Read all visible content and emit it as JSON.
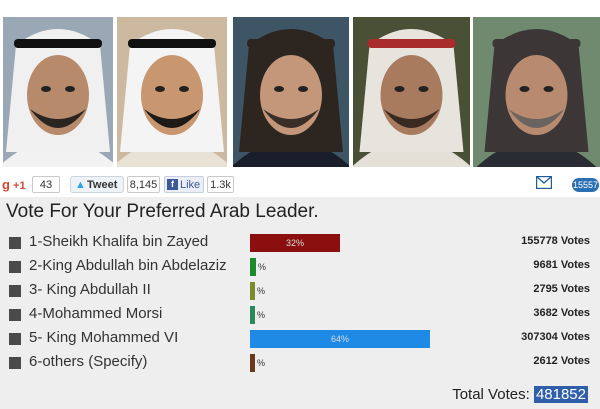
{
  "photos": [
    {
      "name": "leader-photo-1",
      "bg": "#9aa7b5",
      "skin": "#b88a6c",
      "head": "#f0f0f0",
      "band": "#111111",
      "beard": "#2a2520",
      "cloth": "#f2f2f2"
    },
    {
      "name": "leader-photo-2",
      "bg": "#cdb9a0",
      "skin": "#c9976f",
      "head": "#f4f4f4",
      "band": "#111111",
      "beard": "#1e1a18",
      "cloth": "#e8e2d4"
    },
    {
      "name": "leader-photo-3",
      "bg": "#3e5566",
      "skin": "#c4977a",
      "head": "#2d2620",
      "band": "#2d2620",
      "beard": "#3a2e28",
      "cloth": "#1a1e2a"
    },
    {
      "name": "leader-photo-4",
      "bg": "#4a5036",
      "skin": "#a87a5e",
      "head": "#e7e3dd",
      "band": "#a92b2b",
      "beard": "#3a2b22",
      "cloth": "#e4e0d8"
    },
    {
      "name": "leader-photo-5",
      "bg": "#708a70",
      "skin": "#b88a70",
      "head": "#3c3636",
      "band": "#3c3636",
      "beard": "#6a6460",
      "cloth": "#2a2c33"
    }
  ],
  "share": {
    "gplus_label": "+1",
    "gplus_count": "43",
    "tweet_label": "Tweet",
    "tweet_count": "8,145",
    "fb_label": "Like",
    "fb_count": "1.3k",
    "badge": "15557"
  },
  "poll": {
    "title": "Vote For Your Preferred Arab Leader.",
    "options": [
      {
        "label": "1-Sheikh Khalifa bin Zayed",
        "percent": 32,
        "percent_label": "32%",
        "votes": "155778 Votes",
        "color": "#8b0f0f"
      },
      {
        "label": "2-King Abdullah bin Abdelaziz",
        "percent": 2,
        "percent_label": "%",
        "votes": "9681 Votes",
        "color": "#1c8a2a"
      },
      {
        "label": "3- King Abdullah II",
        "percent": 1,
        "percent_label": "%",
        "votes": "2795 Votes",
        "color": "#7c8a2a"
      },
      {
        "label": "4-Mohammed Morsi",
        "percent": 1,
        "percent_label": "%",
        "votes": "3682 Votes",
        "color": "#2a8a5a"
      },
      {
        "label": "5- King Mohammed VI",
        "percent": 64,
        "percent_label": "64%",
        "votes": "307304 Votes",
        "color": "#1e8ae6"
      },
      {
        "label": "6-others (Specify)",
        "percent": 1,
        "percent_label": "%",
        "votes": "2612 Votes",
        "color": "#6b3a1e"
      }
    ],
    "total_label": "Total Votes:",
    "total_value": "481852"
  }
}
